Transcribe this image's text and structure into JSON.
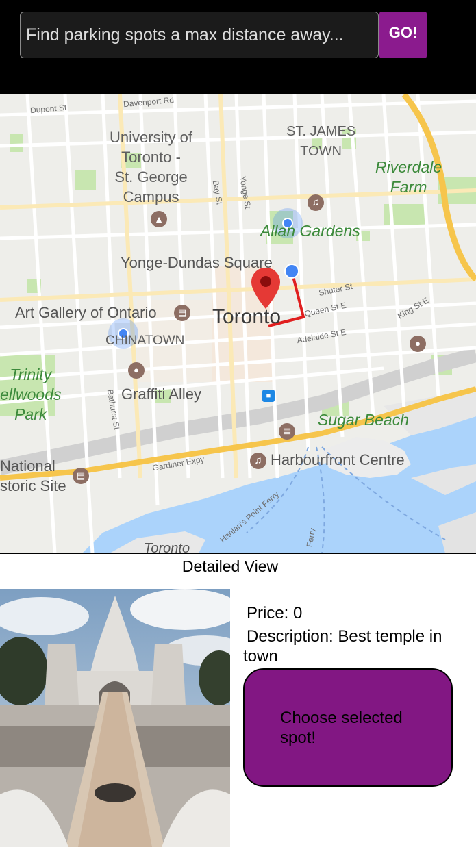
{
  "search": {
    "placeholder": "Find parking spots a max distance away...",
    "value": "",
    "go_label": "GO!"
  },
  "colors": {
    "accent": "#8b1b8e",
    "button_fill": "#821783",
    "route": "#e01f1f",
    "location_dot": "#4285f4",
    "pin": "#e53935",
    "water": "#abd3fb",
    "park": "#c8e6b0"
  },
  "map": {
    "labels": {
      "dupont": "Dupont St",
      "davenport": "Davenport Rd",
      "uoft": "University of\nToronto -\nSt. George\nCampus",
      "st_james": "ST. JAMES\nTOWN",
      "riverdale": "Riverdale\nFarm",
      "allan": "Allan Gardens",
      "bay": "Bay St",
      "yonge": "Yonge St",
      "yonge_dundas": "Yonge-Dundas Square",
      "shuter": "Shuter St",
      "queen": "Queen St E",
      "king": "King St E",
      "ago": "Art Gallery of Ontario",
      "toronto": "Toronto",
      "adelaide": "Adelaide St E",
      "chinatown": "CHINATOWN",
      "trinity": "Trinity\nellwoods\nPark",
      "graffiti": "Graffiti Alley",
      "bathurst": "Bathurst St",
      "sugar": "Sugar Beach",
      "harbourfront": "Harbourfront Centre",
      "national": "National\nstoric Site",
      "gardiner": "Gardiner Expy",
      "hanlans": "Hanlan's Point Ferry",
      "ferry": "Ferry",
      "toronto_island": "Toronto"
    },
    "icons": {
      "university": "graduation-cap-icon",
      "music_allan": "music-note-icon",
      "museum_ago": "museum-icon",
      "camera_graffiti": "camera-icon",
      "camera_east": "camera-icon",
      "transit": "bus-icon",
      "museum_sugar": "museum-icon",
      "music_harbour": "music-note-icon",
      "museum_national": "museum-icon",
      "selected_pin": "map-pin-icon",
      "spot_allan": "location-dot-icon",
      "spot_chinatown": "location-dot-icon",
      "spot_user": "location-dot-icon"
    }
  },
  "detail": {
    "title": "Detailed View",
    "price_label": "Price: 0",
    "description_label": "Description: Best temple in town",
    "choose_label": "Choose selected spot!",
    "photo_icon": "temple-photo"
  }
}
